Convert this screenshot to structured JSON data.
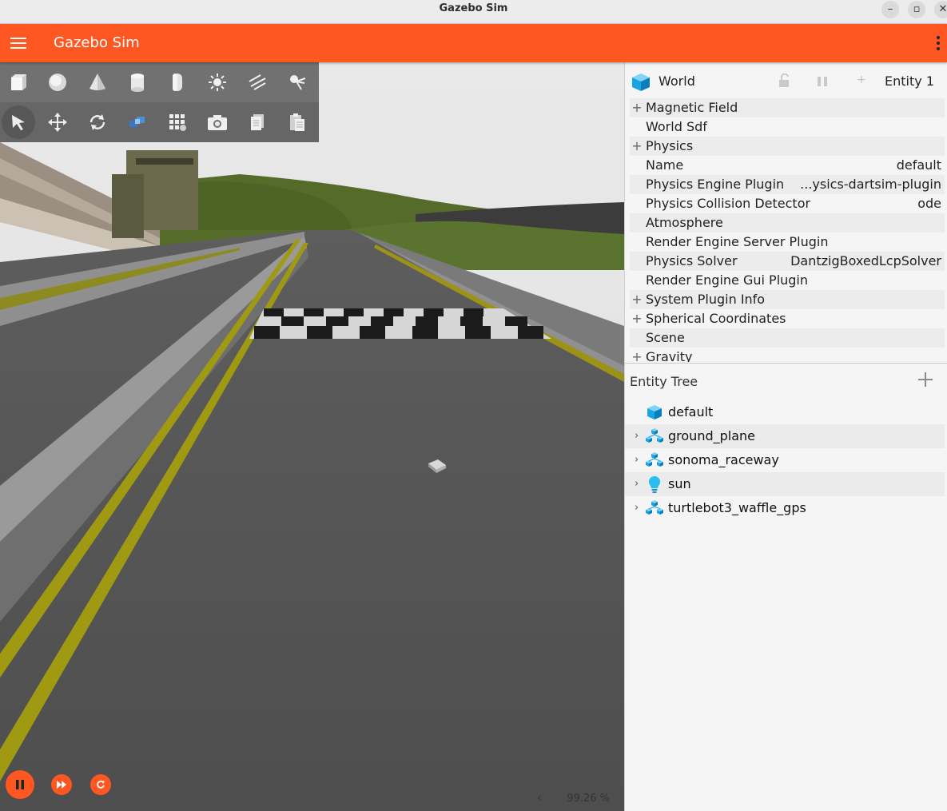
{
  "window": {
    "title": "Gazebo Sim",
    "controls": [
      "minimize-icon",
      "maximize-icon",
      "close-icon"
    ]
  },
  "appbar": {
    "title": "Gazebo Sim",
    "accent_color": "#fe5722",
    "left_icon": "menu-icon",
    "right_icon": "kebab-menu-icon"
  },
  "toolbar": {
    "row1": [
      "box-icon",
      "sphere-icon",
      "cone-icon",
      "cylinder-icon",
      "capsule-icon",
      "point-light-icon",
      "directional-light-icon",
      "spot-light-icon"
    ],
    "row2": [
      "select-icon",
      "translate-icon",
      "rotate-icon",
      "view-angle-icon",
      "grid-snap-icon",
      "screenshot-icon",
      "copy-icon",
      "paste-icon"
    ],
    "active_tool": "select-icon"
  },
  "playback": {
    "controls": [
      "pause-icon",
      "step-icon",
      "reset-icon"
    ],
    "rtf_value": "99.26 %"
  },
  "component_inspector": {
    "entity_type": "World",
    "entity_label": "Entity 1",
    "header_icons": [
      "world-cube-icon",
      "lock-icon",
      "pause-icon",
      "add-icon"
    ],
    "rows": [
      {
        "key": "Magnetic Field",
        "value": "",
        "expandable": true
      },
      {
        "key": "World Sdf",
        "value": "",
        "expandable": false
      },
      {
        "key": "Physics",
        "value": "",
        "expandable": true
      },
      {
        "key": "Name",
        "value": "default",
        "expandable": false
      },
      {
        "key": "Physics Engine Plugin",
        "value": "...ysics-dartsim-plugin",
        "expandable": false
      },
      {
        "key": "Physics Collision Detector",
        "value": "ode",
        "expandable": false
      },
      {
        "key": "Atmosphere",
        "value": "",
        "expandable": false
      },
      {
        "key": "Render Engine Server Plugin",
        "value": "",
        "expandable": false
      },
      {
        "key": "Physics Solver",
        "value": "DantzigBoxedLcpSolver",
        "expandable": false
      },
      {
        "key": "Render Engine Gui Plugin",
        "value": "",
        "expandable": false
      },
      {
        "key": "System Plugin Info",
        "value": "",
        "expandable": true
      },
      {
        "key": "Spherical Coordinates",
        "value": "",
        "expandable": true
      },
      {
        "key": "Scene",
        "value": "",
        "expandable": false
      },
      {
        "key": "Gravity",
        "value": "",
        "expandable": true
      }
    ]
  },
  "entity_tree": {
    "title": "Entity Tree",
    "items": [
      {
        "label": "default",
        "icon": "world-cube-icon",
        "expandable": false
      },
      {
        "label": "ground_plane",
        "icon": "model-icon",
        "expandable": true
      },
      {
        "label": "sonoma_raceway",
        "icon": "model-icon",
        "expandable": true
      },
      {
        "label": "sun",
        "icon": "light-bulb-icon",
        "expandable": true
      },
      {
        "label": "turtlebot3_waffle_gps",
        "icon": "model-icon",
        "expandable": true
      }
    ]
  }
}
